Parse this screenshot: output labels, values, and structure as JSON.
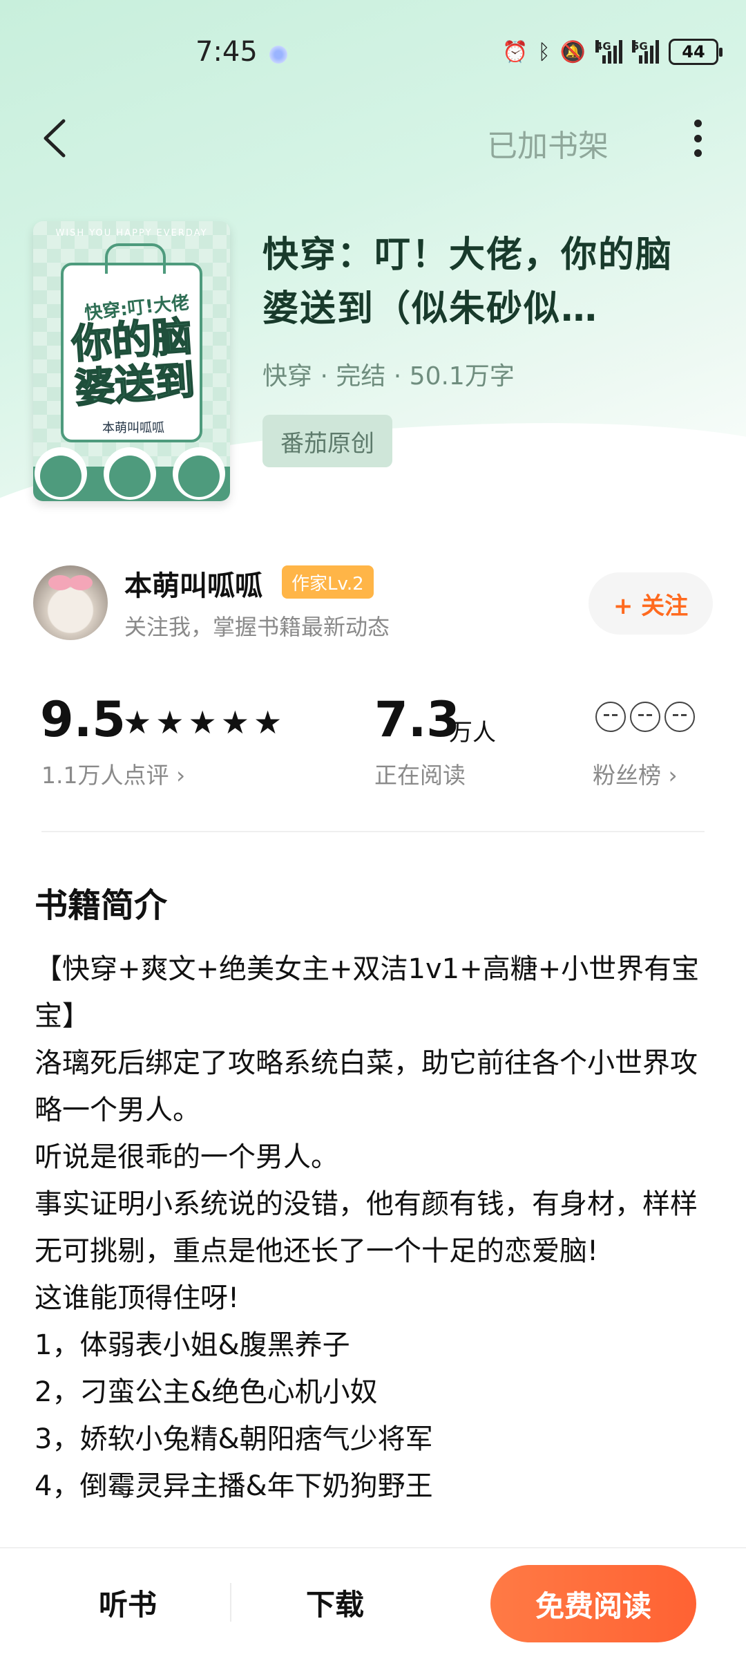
{
  "status_bar": {
    "time": "7:45",
    "network_1": "4G",
    "network_2": "5G",
    "battery": "44"
  },
  "nav": {
    "shelf_status": "已加书架"
  },
  "book": {
    "cover": {
      "top_text": "WISH YOU HAPPY EVERDAY",
      "title_small": "快穿:叮!大佬",
      "title_big": "你的脑婆送到",
      "author": "本萌叫呱呱"
    },
    "title": "快穿：叮！大佬，你的脑婆送到（似朱砂似…",
    "meta": "快穿 · 完结 · 50.1万字",
    "tag": "番茄原创"
  },
  "author": {
    "name": "本萌叫呱呱",
    "badge": "作家Lv.2",
    "description": "关注我，掌握书籍最新动态",
    "follow_label": "+ 关注"
  },
  "stats": {
    "score": "9.5",
    "stars": "★★★★★",
    "reviews": "1.1万人点评 ›",
    "readers": "7.3",
    "readers_unit": "万人",
    "readers_label": "正在阅读",
    "fans_label": "粉丝榜 ›"
  },
  "intro": {
    "title": "书籍简介",
    "lines": [
      "【快穿+爽文+绝美女主+双洁1v1+高糖+小世界有宝宝】",
      "洛璃死后绑定了攻略系统白菜，助它前往各个小世界攻略一个男人。",
      "听说是很乖的一个男人。",
      "事实证明小系统说的没错，他有颜有钱，有身材，样样无可挑剔，重点是他还长了一个十足的恋爱脑!",
      "这谁能顶得住呀!",
      "1，体弱表小姐&腹黑养子",
      "2，刁蛮公主&绝色心机小奴",
      "3，娇软小兔精&朝阳痞气少将军",
      "4，倒霉灵异主播&年下奶狗野王"
    ]
  },
  "bottom_bar": {
    "listen": "听书",
    "download": "下载",
    "read": "免费阅读"
  },
  "colors": {
    "accent": "#ff6a1f",
    "hero_green": "#c8efdc",
    "badge": "#ffb547"
  }
}
